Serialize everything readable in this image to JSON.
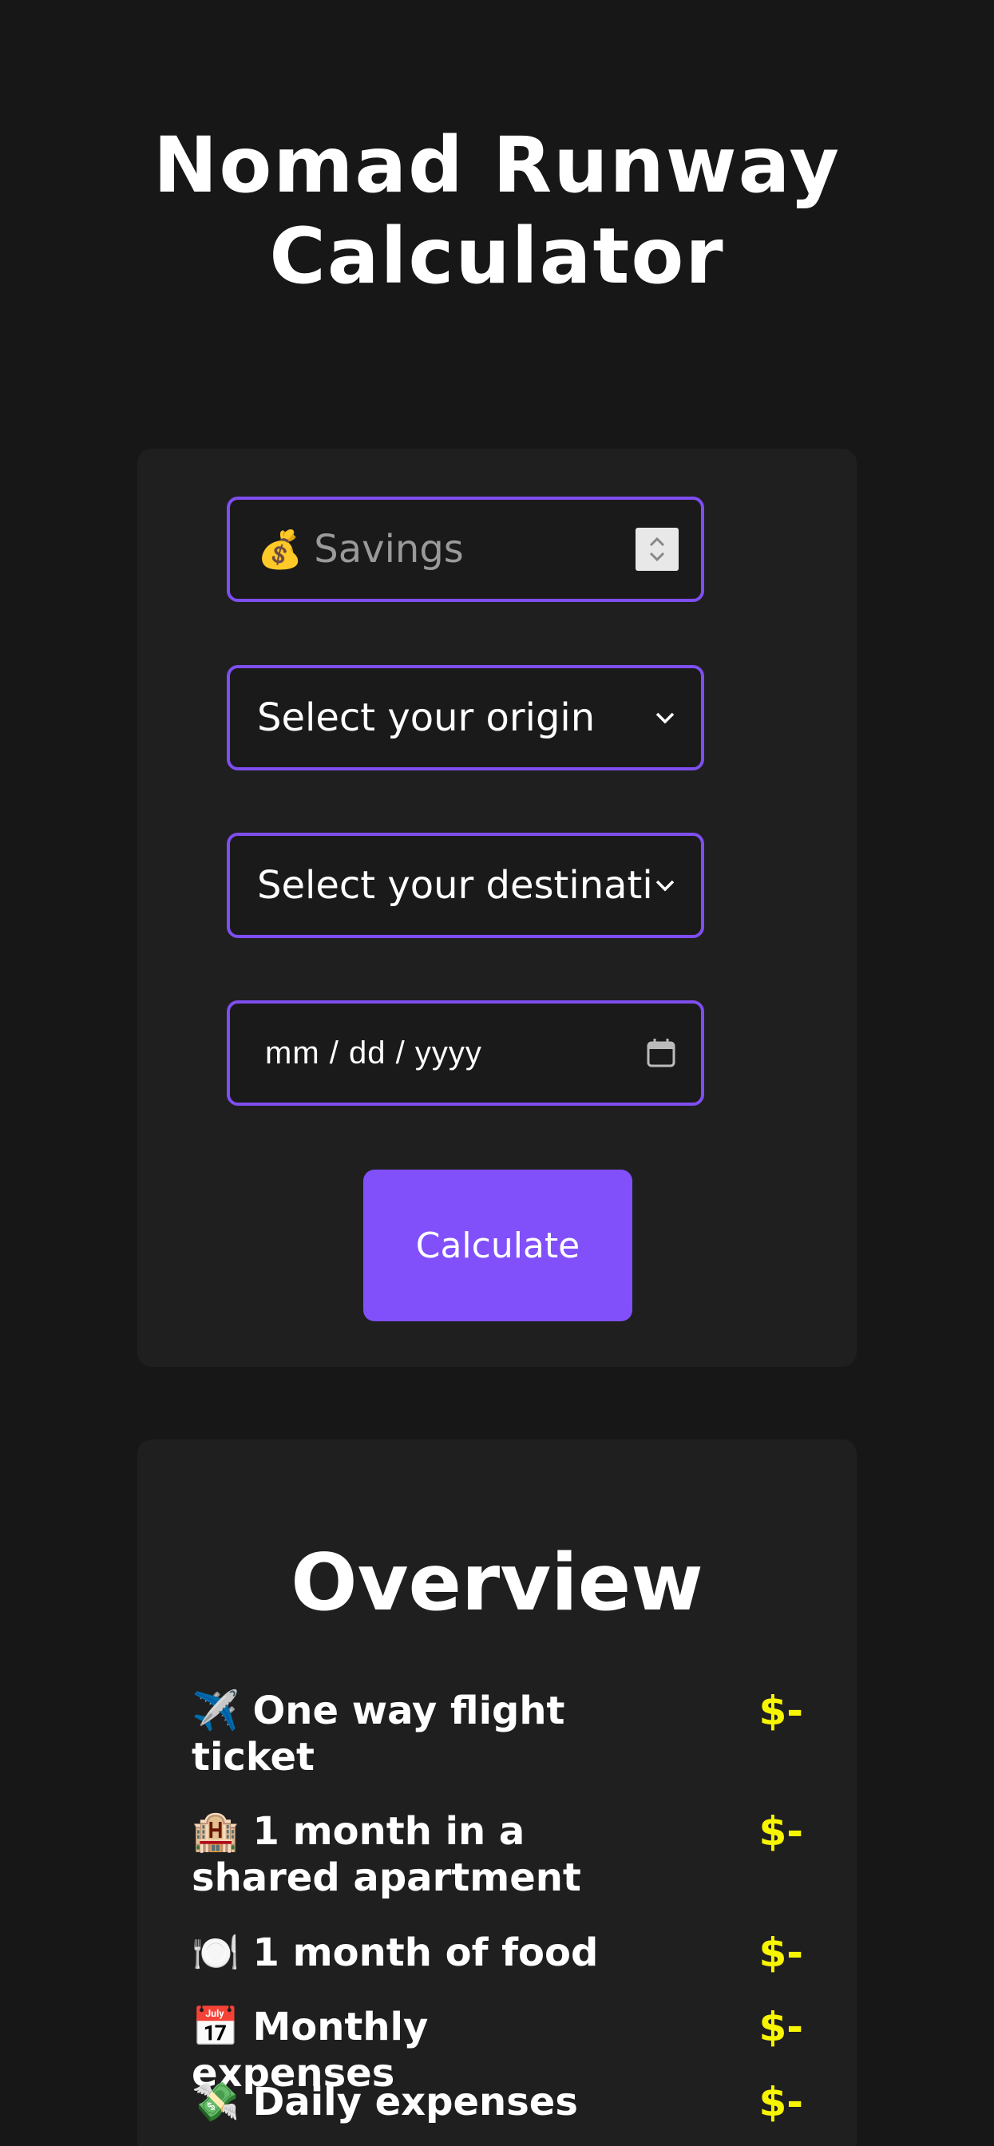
{
  "app": {
    "title": "Nomad Runway Calculator"
  },
  "form": {
    "savings": {
      "icon": "money-bag-icon",
      "emoji": "💰",
      "placeholder": "Savings"
    },
    "origin": {
      "value": "Select your origin"
    },
    "destination": {
      "value": "Select your destination"
    },
    "date": {
      "placeholder": "mm / dd / yyyy"
    },
    "calculate_label": "Calculate"
  },
  "overview": {
    "title": "Overview",
    "items": [
      {
        "emoji": "✈️",
        "icon": "airplane-icon",
        "label": "One way flight ticket",
        "value": "$-"
      },
      {
        "emoji": "🏨",
        "icon": "hotel-icon",
        "label": "1 month in a shared apartment",
        "value": "$-"
      },
      {
        "emoji": "🍽️",
        "icon": "plate-cutlery-icon",
        "label": "1 month of food",
        "value": "$-"
      },
      {
        "emoji": "📅",
        "icon": "calendar-icon",
        "label": "Monthly expenses",
        "value": "$-"
      },
      {
        "emoji": "💸",
        "icon": "money-wings-icon",
        "label": "Daily expenses",
        "value": "$-"
      }
    ]
  },
  "colors": {
    "background": "#171718",
    "card": "#1f1f20",
    "accent": "#8150fb",
    "border": "#7f4ef0",
    "value_yellow": "#f8f500"
  }
}
